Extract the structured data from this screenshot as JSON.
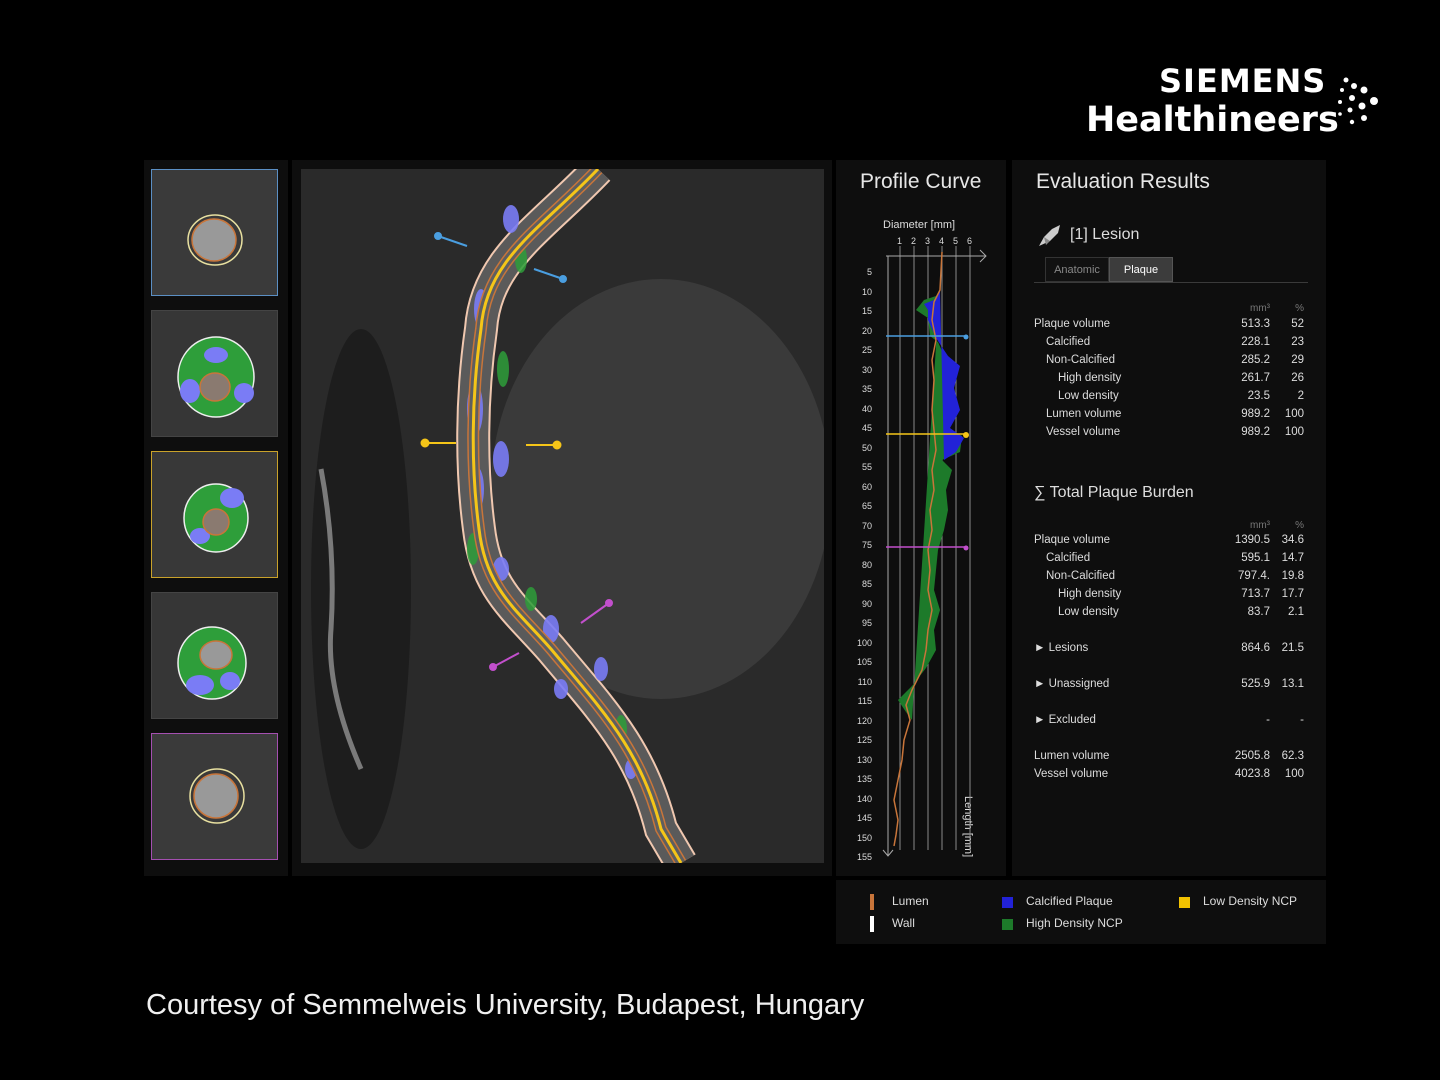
{
  "brand": {
    "line1": "SIEMENS",
    "line2": "Healthineers"
  },
  "profile": {
    "title": "Profile Curve",
    "diameter_label": "Diameter [mm]",
    "diameter_ticks": [
      "1",
      "2",
      "3",
      "4",
      "5",
      "6"
    ],
    "length_label": "Length [mm]",
    "length_ticks": [
      "5",
      "10",
      "15",
      "20",
      "25",
      "30",
      "35",
      "40",
      "45",
      "50",
      "55",
      "60",
      "65",
      "70",
      "75",
      "80",
      "85",
      "90",
      "95",
      "100",
      "105",
      "110",
      "115",
      "120",
      "125",
      "130",
      "135",
      "140",
      "145",
      "150",
      "155"
    ]
  },
  "evaluation": {
    "title": "Evaluation Results",
    "lesion_label": "[1] Lesion",
    "tabs": [
      "Anatomic",
      "Plaque"
    ],
    "active_tab": "Plaque",
    "unit_mm": "mm³",
    "unit_pct": "%",
    "lesion_rows": [
      {
        "label": "Plaque volume",
        "mm3": "513.3",
        "pct": "52",
        "indent": 0
      },
      {
        "label": "Calcified",
        "mm3": "228.1",
        "pct": "23",
        "indent": 1
      },
      {
        "label": "Non-Calcified",
        "mm3": "285.2",
        "pct": "29",
        "indent": 1
      },
      {
        "label": "High density",
        "mm3": "261.7",
        "pct": "26",
        "indent": 2
      },
      {
        "label": "Low density",
        "mm3": "23.5",
        "pct": "2",
        "indent": 2
      },
      {
        "label": "Lumen volume",
        "mm3": "989.2",
        "pct": "100",
        "indent": 1
      },
      {
        "label": "Vessel volume",
        "mm3": "989.2",
        "pct": "100",
        "indent": 1
      }
    ],
    "total_title": "∑ Total Plaque Burden",
    "total_rows": [
      {
        "label": "Plaque volume",
        "mm3": "1390.5",
        "pct": "34.6",
        "indent": 0
      },
      {
        "label": "Calcified",
        "mm3": "595.1",
        "pct": "14.7",
        "indent": 1
      },
      {
        "label": "Non-Calcified",
        "mm3": "797.4.",
        "pct": "19.8",
        "indent": 1
      },
      {
        "label": "High density",
        "mm3": "713.7",
        "pct": "17.7",
        "indent": 2
      },
      {
        "label": "Low density",
        "mm3": "83.7",
        "pct": "2.1",
        "indent": 2
      }
    ],
    "expandable_rows": [
      {
        "label": "► Lesions",
        "mm3": "864.6",
        "pct": "21.5"
      },
      {
        "label": "► Unassigned",
        "mm3": "525.9",
        "pct": "13.1"
      },
      {
        "label": "► Excluded",
        "mm3": "-",
        "pct": "-"
      }
    ],
    "summary_rows": [
      {
        "label": "Lumen volume",
        "mm3": "2505.8",
        "pct": "62.3"
      },
      {
        "label": "Vessel volume",
        "mm3": "4023.8",
        "pct": "100"
      }
    ]
  },
  "legend": {
    "lumen": "Lumen",
    "wall": "Wall",
    "calcified": "Calcified Plaque",
    "high_density": "High Density NCP",
    "low_density": "Low Density NCP"
  },
  "colors": {
    "lumen": "#c8753a",
    "wall": "#ffffff",
    "calcified": "#2222d8",
    "high_density": "#1d7a2a",
    "low_density": "#f2c200",
    "marker_blue": "#4a9ee0",
    "marker_yellow": "#f5c518",
    "marker_magenta": "#c24fcc"
  },
  "courtesy": "Courtesy of Semmelweis University, Budapest, Hungary"
}
